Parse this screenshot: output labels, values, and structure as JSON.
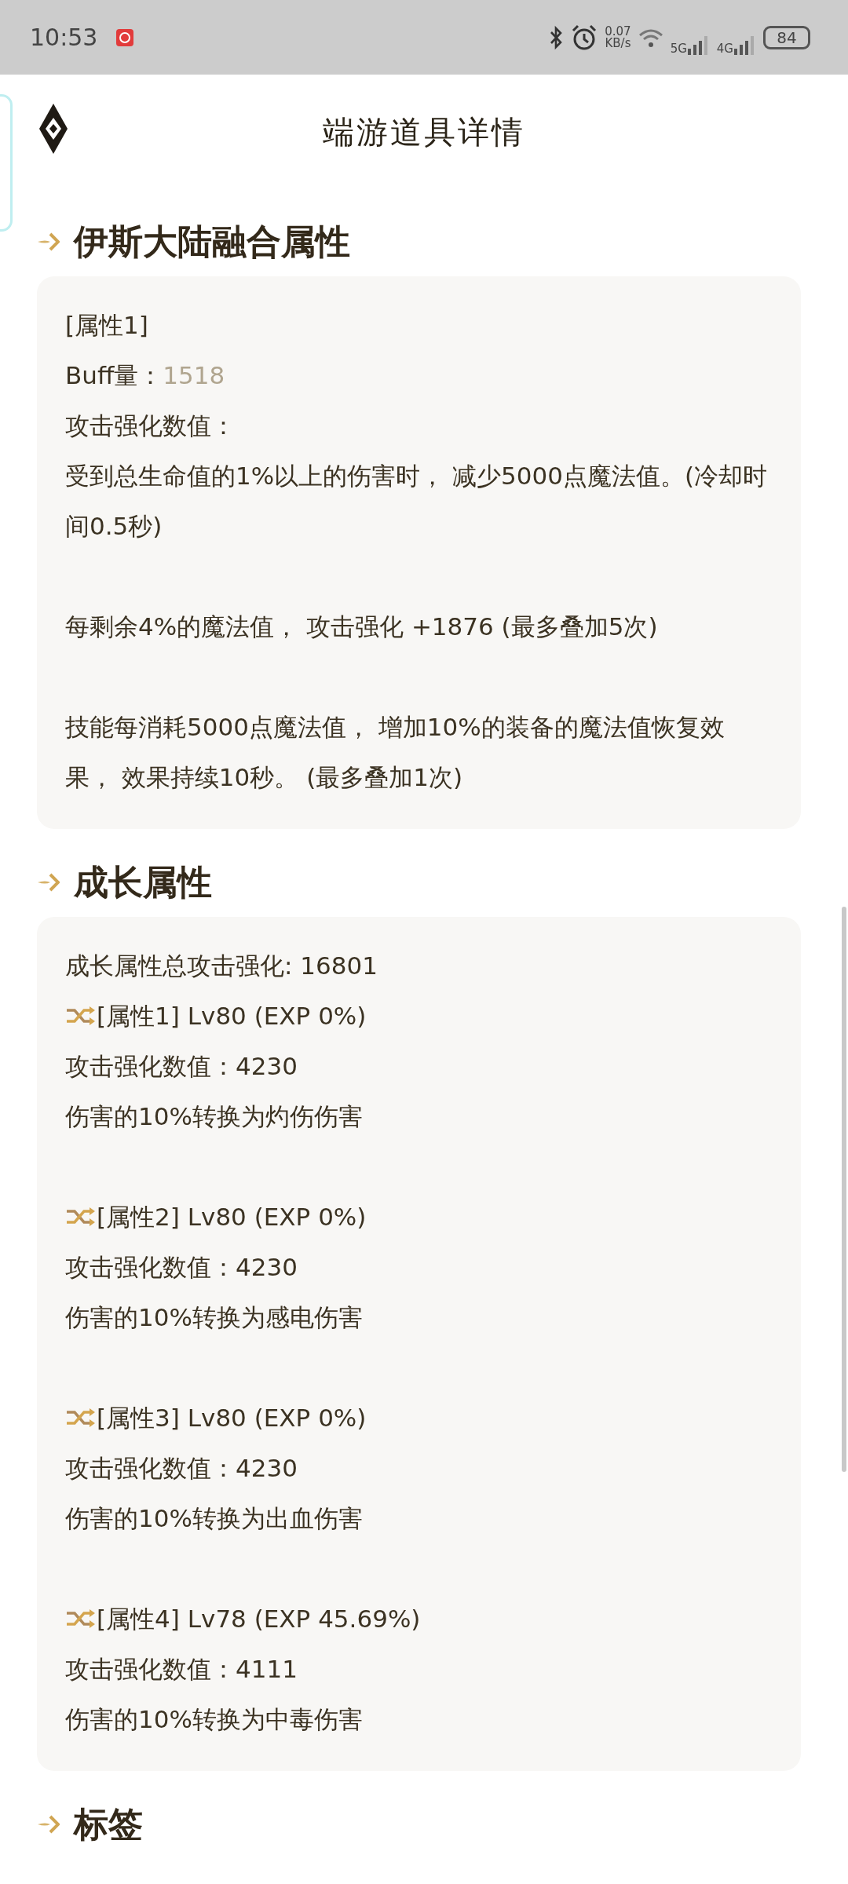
{
  "status_bar": {
    "time": "10:53",
    "net_speed": "0.07",
    "net_unit": "KB/s",
    "sim1": "5G",
    "sim2": "4G",
    "battery": "84"
  },
  "header": {
    "title": "端游道具详情"
  },
  "sections": [
    {
      "title": "伊斯大陆融合属性",
      "paragraphs": [
        [
          {
            "kind": "text",
            "text": "[属性1]"
          },
          {
            "kind": "value",
            "text": "Buff量：",
            "value": "1518"
          },
          {
            "kind": "text",
            "text": "攻击强化数值："
          },
          {
            "kind": "text",
            "text": "受到总生命值的1%以上的伤害时， 减少5000点魔法值。(冷却时间0.5秒)"
          }
        ],
        [
          {
            "kind": "text",
            "text": "每剩余4%的魔法值， 攻击强化 +1876 (最多叠加5次)"
          }
        ],
        [
          {
            "kind": "text",
            "text": "技能每消耗5000点魔法值， 增加10%的装备的魔法值恢复效果， 效果持续10秒。 (最多叠加1次)"
          }
        ]
      ]
    },
    {
      "title": "成长属性",
      "paragraphs": [
        [
          {
            "kind": "text",
            "text": "成长属性总攻击强化: 16801"
          },
          {
            "kind": "shuffle",
            "text": "[属性1] Lv80 (EXP 0%)"
          },
          {
            "kind": "text",
            "text": "攻击强化数值：4230"
          },
          {
            "kind": "text",
            "text": "伤害的10%转换为灼伤伤害"
          }
        ],
        [
          {
            "kind": "shuffle",
            "text": "[属性2] Lv80 (EXP 0%)"
          },
          {
            "kind": "text",
            "text": "攻击强化数值：4230"
          },
          {
            "kind": "text",
            "text": "伤害的10%转换为感电伤害"
          }
        ],
        [
          {
            "kind": "shuffle",
            "text": "[属性3] Lv80 (EXP 0%)"
          },
          {
            "kind": "text",
            "text": "攻击强化数值：4230"
          },
          {
            "kind": "text",
            "text": "伤害的10%转换为出血伤害"
          }
        ],
        [
          {
            "kind": "shuffle",
            "text": "[属性4] Lv78 (EXP 45.69%)"
          },
          {
            "kind": "text",
            "text": "攻击强化数值：4111"
          },
          {
            "kind": "text",
            "text": "伤害的10%转换为中毒伤害"
          }
        ]
      ]
    },
    {
      "title": "标签"
    }
  ]
}
